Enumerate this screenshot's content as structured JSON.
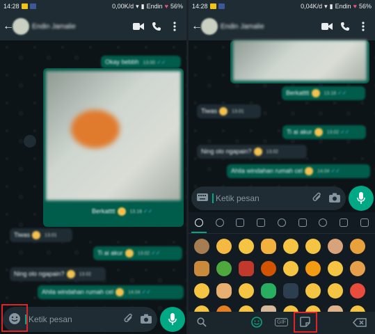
{
  "status": {
    "time": "14:28",
    "speed": "0,00K/d",
    "speed_right": "0,04K/d",
    "carrier": "Endin",
    "battery": "56%"
  },
  "chat": {
    "name": "Endin Jamalie",
    "back": "←"
  },
  "left_messages": [
    {
      "text": "Okay bebbh",
      "time": "13.00"
    },
    {
      "text": "Berkatttt",
      "time": "13.18"
    },
    {
      "text": "Tiwas",
      "time": "13.01"
    },
    {
      "text": "Ti ai akur",
      "time": "13.02"
    },
    {
      "text": "Ning olo ngapain?",
      "time": "13.02"
    },
    {
      "text": "Ahila windahan rumah cel",
      "time": "14.04"
    }
  ],
  "right_messages": [
    {
      "text": "Berkatttt",
      "time": "13.18"
    },
    {
      "text": "Tiwas",
      "time": "13.01"
    },
    {
      "text": "Ti ai akur",
      "time": "13.02"
    },
    {
      "text": "Ning olo ngapain?",
      "time": "13.02"
    },
    {
      "text": "Ahila windahan rumah cel",
      "time": "14.04"
    }
  ],
  "input": {
    "placeholder": "Ketik pesan"
  },
  "bottombar": {
    "gif_label": "GIF"
  },
  "colors": {
    "accent": "#00a884",
    "outgoing_bubble": "#005c4b",
    "highlight_box": "#e0242a"
  },
  "icons": [
    "emoji-icon",
    "attach-icon",
    "camera-icon",
    "mic-icon",
    "video-call-icon",
    "phone-icon",
    "more-icon",
    "keyboard-icon",
    "search-icon",
    "gif-icon",
    "sticker-icon",
    "backspace-icon"
  ]
}
